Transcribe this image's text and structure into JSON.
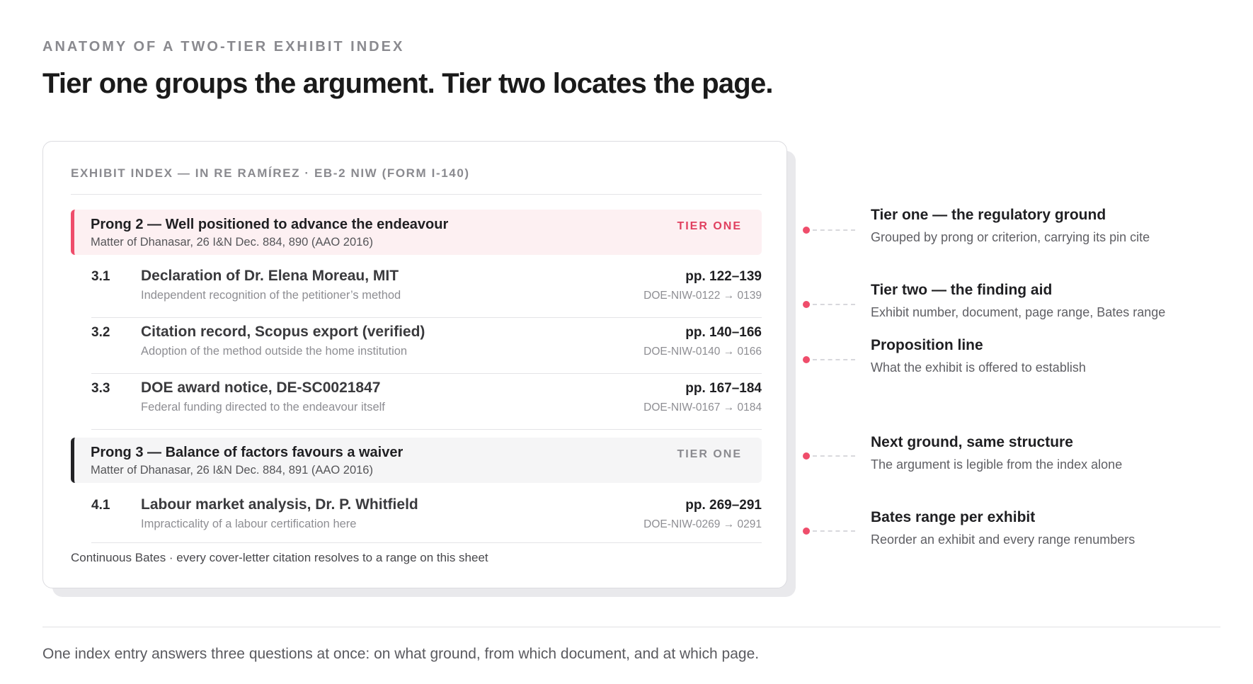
{
  "header": {
    "eyebrow": "ANATOMY OF A TWO-TIER EXHIBIT INDEX",
    "headline": "Tier one groups the argument. Tier two locates the page."
  },
  "card": {
    "title": "EXHIBIT INDEX — IN RE RAMÍREZ · EB-2 NIW (FORM I-140)",
    "groups": [
      {
        "title": "Prong 2 — Well positioned to advance the endeavour",
        "cite": "Matter of Dhanasar, 26 I&N Dec. 884, 890 (AAO 2016)",
        "tag": "TIER ONE",
        "accent": "#ef4d6b",
        "exhibits": [
          {
            "number": "3.1",
            "document": "Declaration of Dr. Elena Moreau, MIT",
            "proposition": "Independent recognition of the petitioner’s method",
            "pages": "pp. 122–139",
            "bates": "DOE-NIW-0122 → 0139"
          },
          {
            "number": "3.2",
            "document": "Citation record, Scopus export (verified)",
            "proposition": "Adoption of the method outside the home institution",
            "pages": "pp. 140–166",
            "bates": "DOE-NIW-0140 → 0166"
          },
          {
            "number": "3.3",
            "document": "DOE award notice, DE-SC0021847",
            "proposition": "Federal funding directed to the endeavour itself",
            "pages": "pp. 167–184",
            "bates": "DOE-NIW-0167 → 0184"
          }
        ]
      },
      {
        "title": "Prong 3 — Balance of factors favours a waiver",
        "cite": "Matter of Dhanasar, 26 I&N Dec. 884, 891 (AAO 2016)",
        "tag": "TIER ONE",
        "accent": "#222225",
        "exhibits": [
          {
            "number": "4.1",
            "document": "Labour market analysis, Dr. P. Whitfield",
            "proposition": "Impracticality of a labour certification here",
            "pages": "pp. 269–291",
            "bates": "DOE-NIW-0269 → 0291"
          }
        ]
      }
    ],
    "footnote": "Continuous Bates · every cover-letter citation resolves to a range on this sheet"
  },
  "callouts": [
    {
      "title": "Tier one — the regulatory ground",
      "desc": "Grouped by prong or criterion, carrying its pin cite"
    },
    {
      "title": "Tier two — the finding aid",
      "desc": "Exhibit number, document, page range, Bates range"
    },
    {
      "title": "Proposition line",
      "desc": "What the exhibit is offered to establish"
    },
    {
      "title": "Next ground, same structure",
      "desc": "The argument is legible from the index alone"
    },
    {
      "title": "Bates range per exhibit",
      "desc": "Reorder an exhibit and every range renumbers"
    }
  ],
  "summary": "One index entry answers three questions at once: on what ground, from which document, and at which page.",
  "colors": {
    "accent": "#ef4d6b",
    "muted": "#8a8a8f"
  }
}
